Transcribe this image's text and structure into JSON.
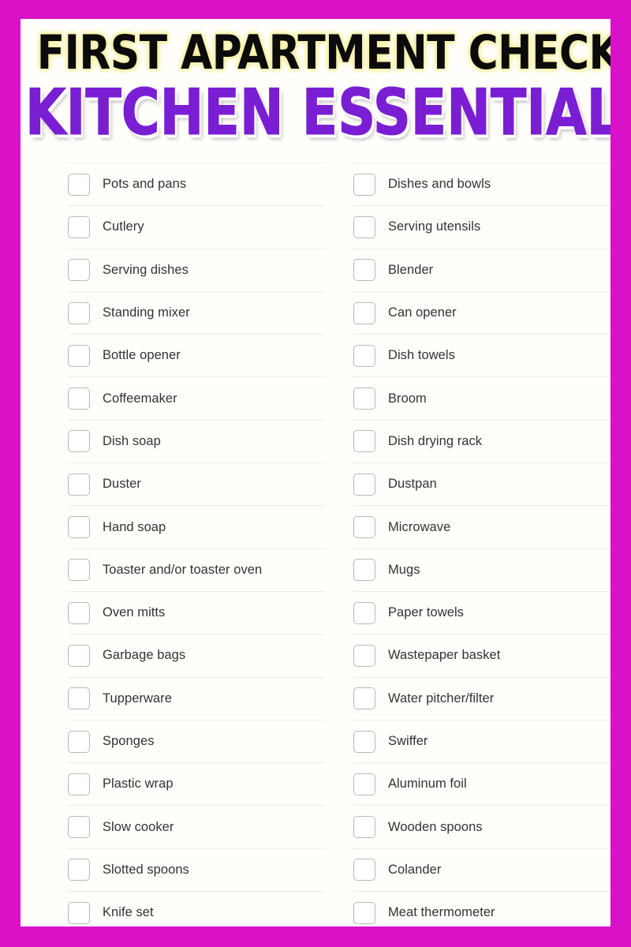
{
  "poster": {
    "border_color": "#d912c8",
    "card_background": "#fffefb"
  },
  "heading": {
    "title": "FIRST APARTMENT CHECKLIST",
    "title_color": "#0b0b0b",
    "title_glow_color": "#f7f2ad",
    "subtitle": "KITCHEN ESSENTIALS",
    "subtitle_color": "#7a1ed4",
    "subtitle_shadow_color": "#ffffff"
  },
  "checklist": {
    "checkbox_border_color": "#b9b9b9",
    "divider_color": "#ececec",
    "label_color": "#333333",
    "left_column": [
      {
        "label": "Pots and pans",
        "checked": false
      },
      {
        "label": "Cutlery",
        "checked": false
      },
      {
        "label": "Serving dishes",
        "checked": false
      },
      {
        "label": "Standing mixer",
        "checked": false
      },
      {
        "label": "Bottle opener",
        "checked": false
      },
      {
        "label": "Coffeemaker",
        "checked": false
      },
      {
        "label": "Dish soap",
        "checked": false
      },
      {
        "label": "Duster",
        "checked": false
      },
      {
        "label": "Hand soap",
        "checked": false
      },
      {
        "label": "Toaster and/or toaster oven",
        "checked": false
      },
      {
        "label": "Oven mitts",
        "checked": false
      },
      {
        "label": "Garbage bags",
        "checked": false
      },
      {
        "label": "Tupperware",
        "checked": false
      },
      {
        "label": "Sponges",
        "checked": false
      },
      {
        "label": "Plastic wrap",
        "checked": false
      },
      {
        "label": "Slow cooker",
        "checked": false
      },
      {
        "label": "Slotted spoons",
        "checked": false
      },
      {
        "label": "Knife set",
        "checked": false
      }
    ],
    "right_column": [
      {
        "label": "Dishes and bowls",
        "checked": false
      },
      {
        "label": "Serving utensils",
        "checked": false
      },
      {
        "label": "Blender",
        "checked": false
      },
      {
        "label": "Can opener",
        "checked": false
      },
      {
        "label": "Dish towels",
        "checked": false
      },
      {
        "label": "Broom",
        "checked": false
      },
      {
        "label": "Dish drying rack",
        "checked": false
      },
      {
        "label": "Dustpan",
        "checked": false
      },
      {
        "label": "Microwave",
        "checked": false
      },
      {
        "label": "Mugs",
        "checked": false
      },
      {
        "label": "Paper towels",
        "checked": false
      },
      {
        "label": "Wastepaper basket",
        "checked": false
      },
      {
        "label": "Water pitcher/filter",
        "checked": false
      },
      {
        "label": "Swiffer",
        "checked": false
      },
      {
        "label": "Aluminum foil",
        "checked": false
      },
      {
        "label": "Wooden spoons",
        "checked": false
      },
      {
        "label": "Colander",
        "checked": false
      },
      {
        "label": "Meat thermometer",
        "checked": false
      }
    ]
  }
}
